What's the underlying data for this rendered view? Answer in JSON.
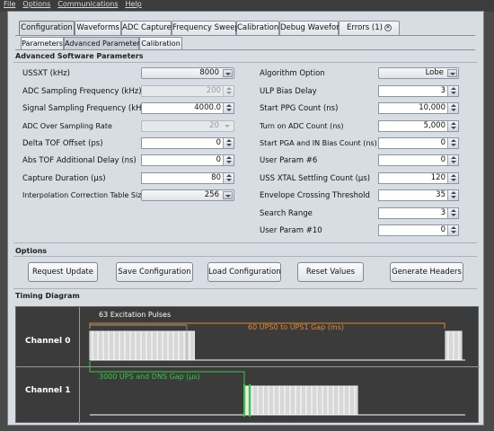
{
  "menu": [
    "File",
    "Options",
    "Communications",
    "Help"
  ],
  "main_tabs": [
    {
      "label": "Configuration"
    },
    {
      "label": "Waveforms"
    },
    {
      "label": "ADC Capture"
    },
    {
      "label": "Frequency Sweep"
    },
    {
      "label": "Calibration"
    },
    {
      "label": "Debug Waveform"
    },
    {
      "label": "Errors (1)"
    }
  ],
  "sub_tabs": [
    {
      "label": "Parameters"
    },
    {
      "label": "Advanced Parameters"
    },
    {
      "label": "Calibration"
    }
  ],
  "advanced": {
    "title": "Advanced Software Parameters",
    "left": [
      {
        "label": "USSXT (kHz)",
        "value": "8000",
        "kind": "combo"
      },
      {
        "label": "ADC Sampling Frequency (kHz)",
        "value": "200",
        "kind": "spin-disabled"
      },
      {
        "label": "Signal Sampling Frequency (kHz)",
        "value": "4000.0",
        "kind": "spin"
      },
      {
        "label": "ADC Over Sampling Rate",
        "value": "20",
        "kind": "combo-disabled"
      },
      {
        "label": "Delta TOF Offset (ps)",
        "value": "0",
        "kind": "spin"
      },
      {
        "label": "Abs TOF Additional Delay (ns)",
        "value": "0",
        "kind": "spin"
      },
      {
        "label": "Capture Duration (µs)",
        "value": "80",
        "kind": "spin"
      },
      {
        "label": "Interpolation Correction Table Size",
        "value": "256",
        "kind": "combo"
      }
    ],
    "right": [
      {
        "label": "Algorithm Option",
        "value": "Lobe",
        "kind": "combo"
      },
      {
        "label": "ULP Bias Delay",
        "value": "3",
        "kind": "spin"
      },
      {
        "label": "Start PPG Count (ns)",
        "value": "10,000",
        "kind": "spin"
      },
      {
        "label": "Turn on ADC Count (ns)",
        "value": "5,000",
        "kind": "spin"
      },
      {
        "label": "Start PGA and IN Bias Count (ns)",
        "value": "0",
        "kind": "spin"
      },
      {
        "label": "User Param #6",
        "value": "0",
        "kind": "spin"
      },
      {
        "label": "USS XTAL Settling Count (µs)",
        "value": "120",
        "kind": "spin"
      },
      {
        "label": "Envelope Crossing Threshold",
        "value": "35",
        "kind": "spin"
      },
      {
        "label": "Search Range",
        "value": "3",
        "kind": "spin"
      },
      {
        "label": "User Param #10",
        "value": "0",
        "kind": "spin"
      }
    ]
  },
  "options": {
    "title": "Options",
    "buttons": [
      "Request Update",
      "Save Configuration",
      "Load Configuration",
      "Reset Values",
      "Generate Headers"
    ]
  },
  "timing": {
    "title": "Timing Diagram",
    "channel0": "Channel 0",
    "channel1": "Channel 1",
    "excitation_label": "63 Excitation Pulses",
    "gap01_label": "60 UPS0 to UPS1 Gap (ms)",
    "ups_dns_label": "3000 UPS and DNS Gap (µs)",
    "colors": {
      "white": "#ffffff",
      "orange": "#e08a2a",
      "green": "#2ecc40"
    }
  }
}
